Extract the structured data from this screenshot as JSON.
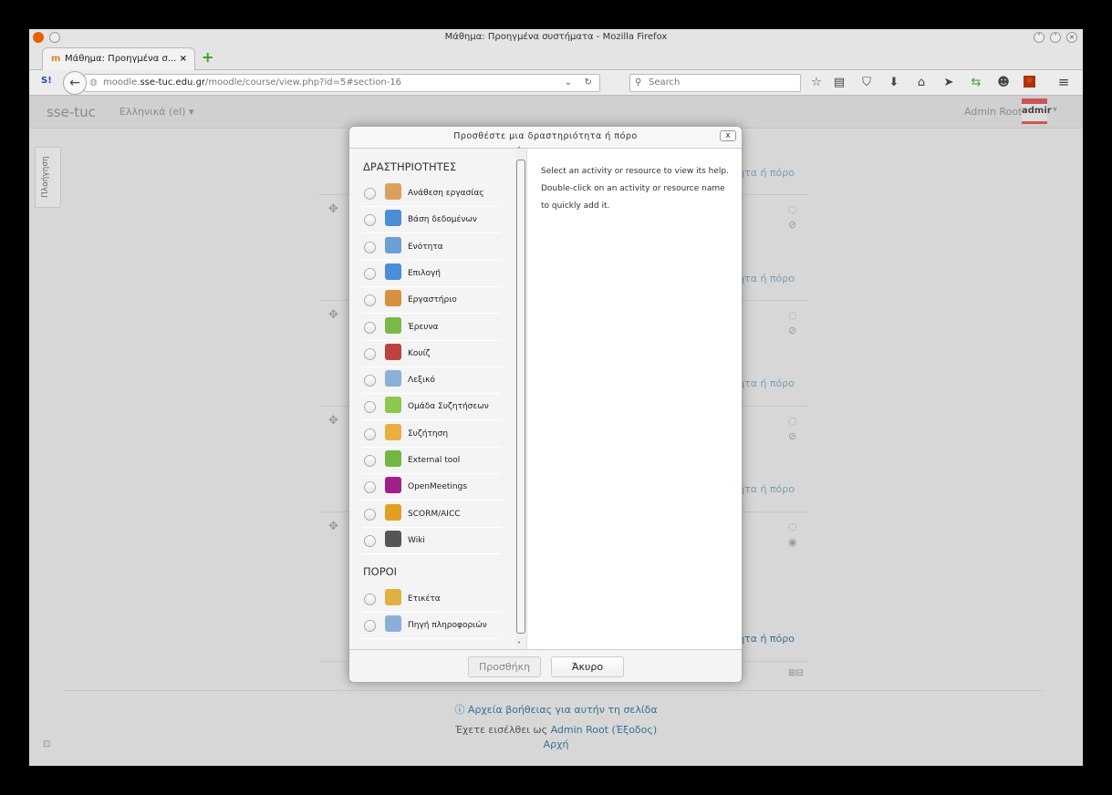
{
  "window": {
    "title": "Μάθημα: Προηγμένα συστήματα - Mozilla Firefox"
  },
  "tab": {
    "label": "Μάθημα: Προηγμένα σ...",
    "close": "×",
    "new_tab": "+"
  },
  "nav": {
    "url_host_pre": "moodle.",
    "url_host": "sse-tuc.edu.gr",
    "url_path": "/moodle/course/view.php?id=5#section-16",
    "search_placeholder": "Search"
  },
  "header": {
    "brand": "sse-tuc",
    "language": "Ελληνικά (el) ▾",
    "user": "Admin Root",
    "avatar_text": "admir",
    "caret": "▾"
  },
  "sidebar": {
    "navigation_tab": "Πλοήγηση"
  },
  "course": {
    "add_link": "Προσθέστε μια δραστηριότητα ή πόρο"
  },
  "modal": {
    "title": "Προσθέστε μια δραστηριότητα ή πόρο",
    "close": "x",
    "activities_heading": "ΔΡΑΣΤΗΡΙΟΤΗΤΕΣ",
    "activities": [
      {
        "label": "Ανάθεση εργασίας",
        "icon": "assignment-icon",
        "color": "#d9a060"
      },
      {
        "label": "Βάση δεδομένων",
        "icon": "database-icon",
        "color": "#4a8ed8"
      },
      {
        "label": "Ενότητα",
        "icon": "lesson-icon",
        "color": "#6a9fd8"
      },
      {
        "label": "Επιλογή",
        "icon": "choice-question-icon",
        "color": "#4a8ed8"
      },
      {
        "label": "Εργαστήριο",
        "icon": "workshop-icon",
        "color": "#d89040"
      },
      {
        "label": "Έρευνα",
        "icon": "survey-chart-icon",
        "color": "#7cb848"
      },
      {
        "label": "Κουίζ",
        "icon": "quiz-check-icon",
        "color": "#c04040"
      },
      {
        "label": "Λεξικό",
        "icon": "glossary-icon",
        "color": "#8ab0d8"
      },
      {
        "label": "Ομάδα Συζητήσεων",
        "icon": "chat-icon",
        "color": "#8cc850"
      },
      {
        "label": "Συζήτηση",
        "icon": "forum-icon",
        "color": "#e8b040"
      },
      {
        "label": "External tool",
        "icon": "puzzle-icon",
        "color": "#70b840"
      },
      {
        "label": "OpenMeetings",
        "icon": "openmeetings-icon",
        "color": "#a0208a"
      },
      {
        "label": "SCORM/AICC",
        "icon": "scorm-package-icon",
        "color": "#e0a020"
      },
      {
        "label": "Wiki",
        "icon": "wiki-icon",
        "color": "#555555"
      }
    ],
    "resources_heading": "ΠΟΡΟΙ",
    "resources": [
      {
        "label": "Ετικέτα",
        "icon": "label-tag-icon",
        "color": "#e0b040"
      },
      {
        "label": "Πηγή πληροφοριών",
        "icon": "file-icon",
        "color": "#8ab0d8"
      }
    ],
    "help_text": "Select an activity or resource to view its help. Double-click on an activity or resource name to quickly add it.",
    "add_button": "Προσθήκη",
    "cancel_button": "Άκυρο"
  },
  "footer": {
    "help_link": "Αρχεία βοήθειας για αυτήν τη σελίδα",
    "logged_in_prefix": "Έχετε εισέλθει ως ",
    "user_link": "Admin Root",
    "logout": " (Έξοδος)",
    "home": "Αρχή"
  }
}
